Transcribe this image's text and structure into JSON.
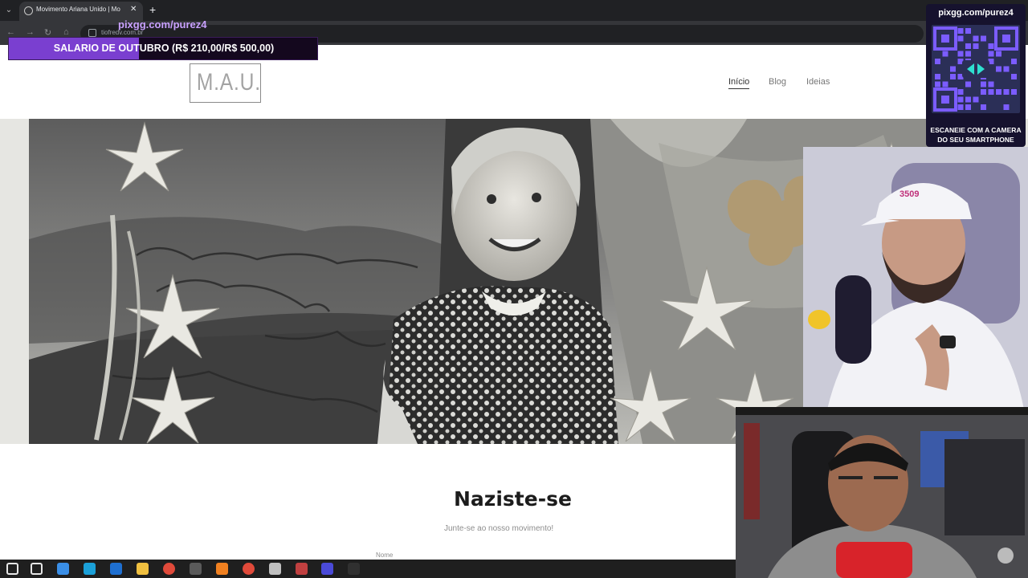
{
  "browser": {
    "tab_title": "Movimento Ariana Unido | Mo",
    "url": "tiofredv.com.br"
  },
  "site": {
    "logo_text": "M.A.U.",
    "nav": [
      {
        "label": "Início",
        "active": true
      },
      {
        "label": "Blog",
        "active": false
      },
      {
        "label": "Ideias",
        "active": false
      }
    ],
    "heading": "Naziste-se",
    "subheading": "Junte-se ao nosso movimento!",
    "form_field_label": "Nome"
  },
  "overlay": {
    "pix_url": "pixgg.com/purez4",
    "salary_text": "SALARIO DE OUTUBRO (R$ 210,00/R$ 500,00)",
    "salary_progress": 0.42,
    "qr_url": "pixgg.com/purez4",
    "qr_caption_line1": "ESCANEIE COM A CAMERA",
    "qr_caption_line2": "DO SEU SMARTPHONE"
  },
  "colors": {
    "progress_fill": "#7a3fd0",
    "qr_accent": "#7b5cff",
    "qr_center": "#2fe0d0"
  },
  "taskbar": {
    "icons": [
      "windows-start-icon",
      "search-icon",
      "copilot-icon",
      "edge-icon",
      "outlook-icon",
      "file-explorer-icon",
      "chrome-icon",
      "app-icon",
      "vlc-icon",
      "chrome-profile-icon",
      "app-icon",
      "app-icon",
      "v-app-icon",
      "obs-icon"
    ]
  }
}
